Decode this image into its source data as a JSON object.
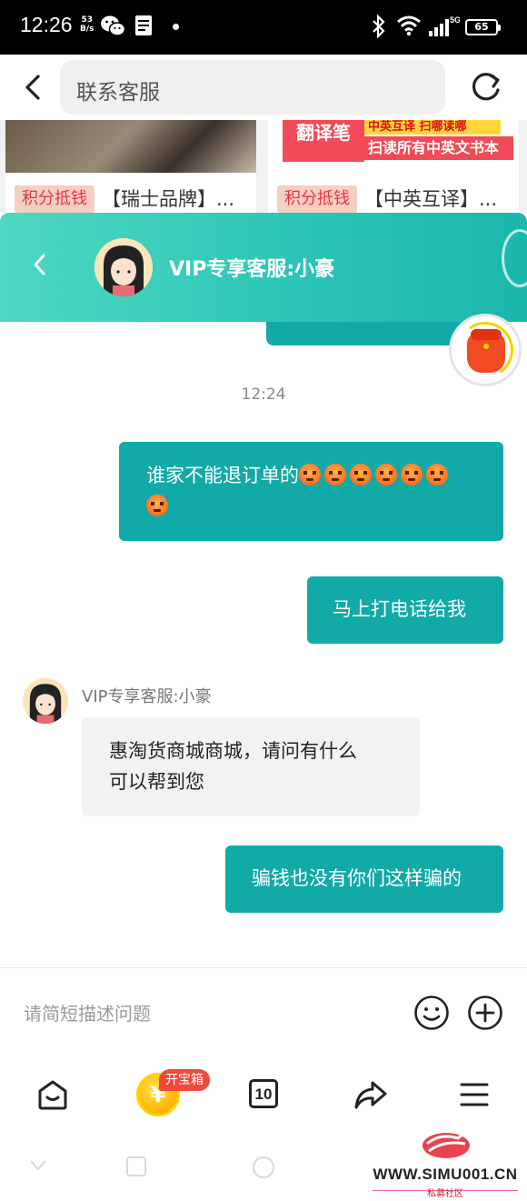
{
  "status_bar": {
    "time": "12:26",
    "net_speed_value": "53",
    "net_speed_unit": "B/s",
    "battery": "65",
    "network": "5G",
    "icons": [
      "wechat-icon",
      "notes-icon",
      "bluetooth-icon",
      "wifi-icon",
      "signal-icon",
      "battery-icon"
    ]
  },
  "top_bar": {
    "search_text": "联系客服",
    "icons": [
      "back-icon",
      "refresh-icon"
    ]
  },
  "products": [
    {
      "tag": "积分抵钱",
      "title": "【瑞士品牌】..."
    },
    {
      "tag": "积分抵钱",
      "title": "【中英互译】...",
      "banner_line1": "翻译笔",
      "banner_tag": "中英互译 扫哪读哪",
      "banner_line2": "扫读所有中英文书本"
    }
  ],
  "chat_header": {
    "title": "VIP专享客服:小豪"
  },
  "chat": {
    "timestamp": "12:24",
    "messages": [
      {
        "from": "user",
        "text": "谁家不能退订单的",
        "emoji_count": 7
      },
      {
        "from": "user",
        "text": "马上打电话给我"
      },
      {
        "from": "agent",
        "name": "VIP专享客服:小豪",
        "line1": "惠淘货商城商城，请问有什么",
        "line2": "可以帮到您"
      },
      {
        "from": "user",
        "text": "骗钱也没有你们这样骗的"
      }
    ]
  },
  "input": {
    "placeholder": "请简短描述问题"
  },
  "toolbar": {
    "badge": "开宝箱",
    "coin_symbol": "¥",
    "tab_count": "10",
    "icons": [
      "home-icon",
      "coin-icon",
      "tabs-icon",
      "share-icon",
      "menu-icon"
    ]
  },
  "watermark": {
    "url": "WWW.SIMU001.CN",
    "subtitle": "私募社区"
  },
  "colors": {
    "accent": "#12aaa6",
    "header_gradient_start": "#4ed8c0",
    "header_gradient_end": "#1bb7ad",
    "tag_red": "#e34444"
  }
}
